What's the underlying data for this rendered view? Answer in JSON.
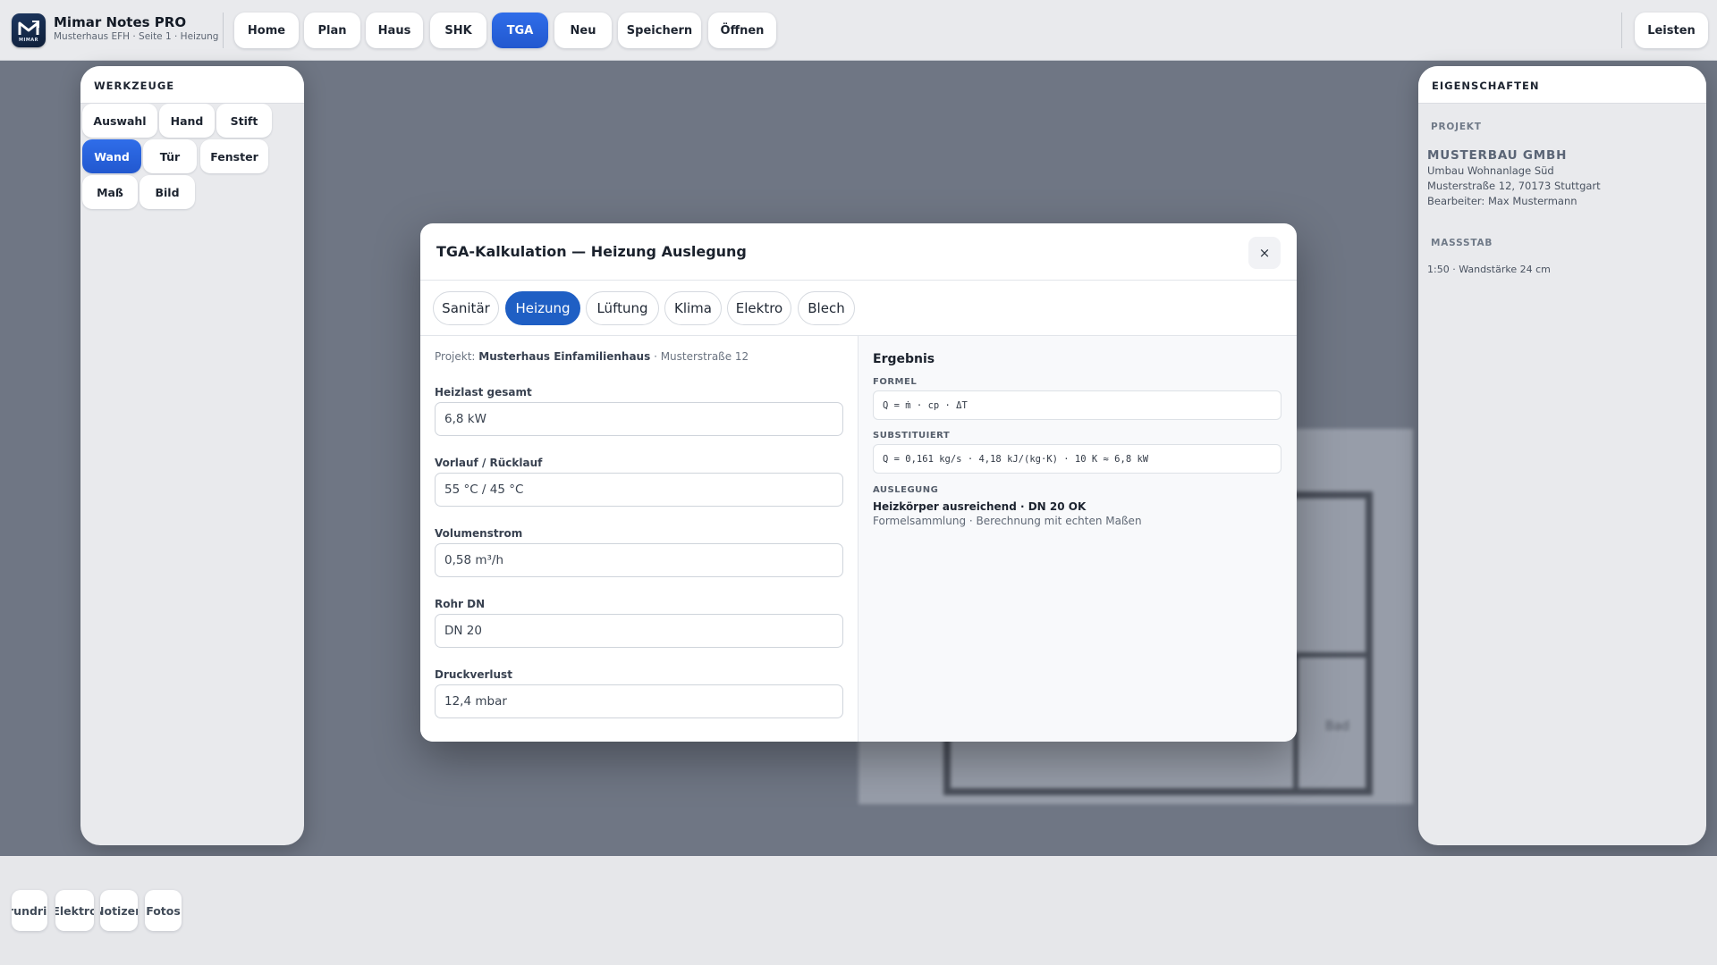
{
  "app": {
    "title": "Mimar Notes PRO",
    "subtitle": "Musterhaus EFH · Seite 1 · Heizung",
    "logo_text": "MIMAR"
  },
  "topnav": {
    "items": [
      "Home",
      "Plan",
      "Haus",
      "SHK",
      "TGA",
      "Neu",
      "Speichern",
      "Öffnen"
    ],
    "active": "TGA",
    "right_button": "Leisten"
  },
  "tools_panel": {
    "title": "WERKZEUGE",
    "tools": [
      "Auswahl",
      "Hand",
      "Stift",
      "Wand",
      "Tür",
      "Fenster",
      "Maß",
      "Bild"
    ],
    "active": "Wand"
  },
  "properties_panel": {
    "title": "EIGENSCHAFTEN",
    "project_section": "PROJEKT",
    "company": "MUSTERBAU GMBH",
    "project_name": "Umbau Wohnanlage Süd",
    "address": "Musterstraße 12, 70173 Stuttgart",
    "editor": "Bearbeiter: Max Mustermann",
    "scale_section": "MASSSTAB",
    "scale_value": "1:50 · Wandstärke 24 cm"
  },
  "canvas": {
    "room_label": "Bad"
  },
  "bottom_tabs": [
    "Grundriss",
    "Elektro",
    "Notizen",
    "Fotos"
  ],
  "modal": {
    "title": "TGA-Kalkulation — Heizung Auslegung",
    "close_label": "×",
    "tabs": [
      "Sanitär",
      "Heizung",
      "Lüftung",
      "Klima",
      "Elektro",
      "Blech"
    ],
    "active_tab": "Heizung",
    "project_prefix": "Projekt:",
    "project_name": "Musterhaus Einfamilienhaus",
    "project_address": "· Musterstraße 12",
    "fields": [
      {
        "label": "Heizlast gesamt",
        "value": "6,8 kW"
      },
      {
        "label": "Vorlauf / Rücklauf",
        "value": "55 °C / 45 °C"
      },
      {
        "label": "Volumenstrom",
        "value": "0,58 m³/h"
      },
      {
        "label": "Rohr DN",
        "value": "DN 20"
      },
      {
        "label": "Druckverlust",
        "value": "12,4 mbar"
      }
    ],
    "result": {
      "title": "Ergebnis",
      "formula_label": "FORMEL",
      "formula": "Q = ṁ · cp · ΔT",
      "substituted_label": "SUBSTITUIERT",
      "substituted": "Q = 0,161 kg/s · 4,18 kJ/(kg·K) · 10 K ≈ 6,8 kW",
      "design_label": "AUSLEGUNG",
      "design_result": "Heizkörper ausreichend · DN 20 OK",
      "design_note": "Formelsammlung · Berechnung mit echten Maßen"
    }
  },
  "colors": {
    "accent": "#2563EB",
    "modal_tab_active": "#1F5FC4",
    "overlay_canvas": "#6F7684"
  }
}
